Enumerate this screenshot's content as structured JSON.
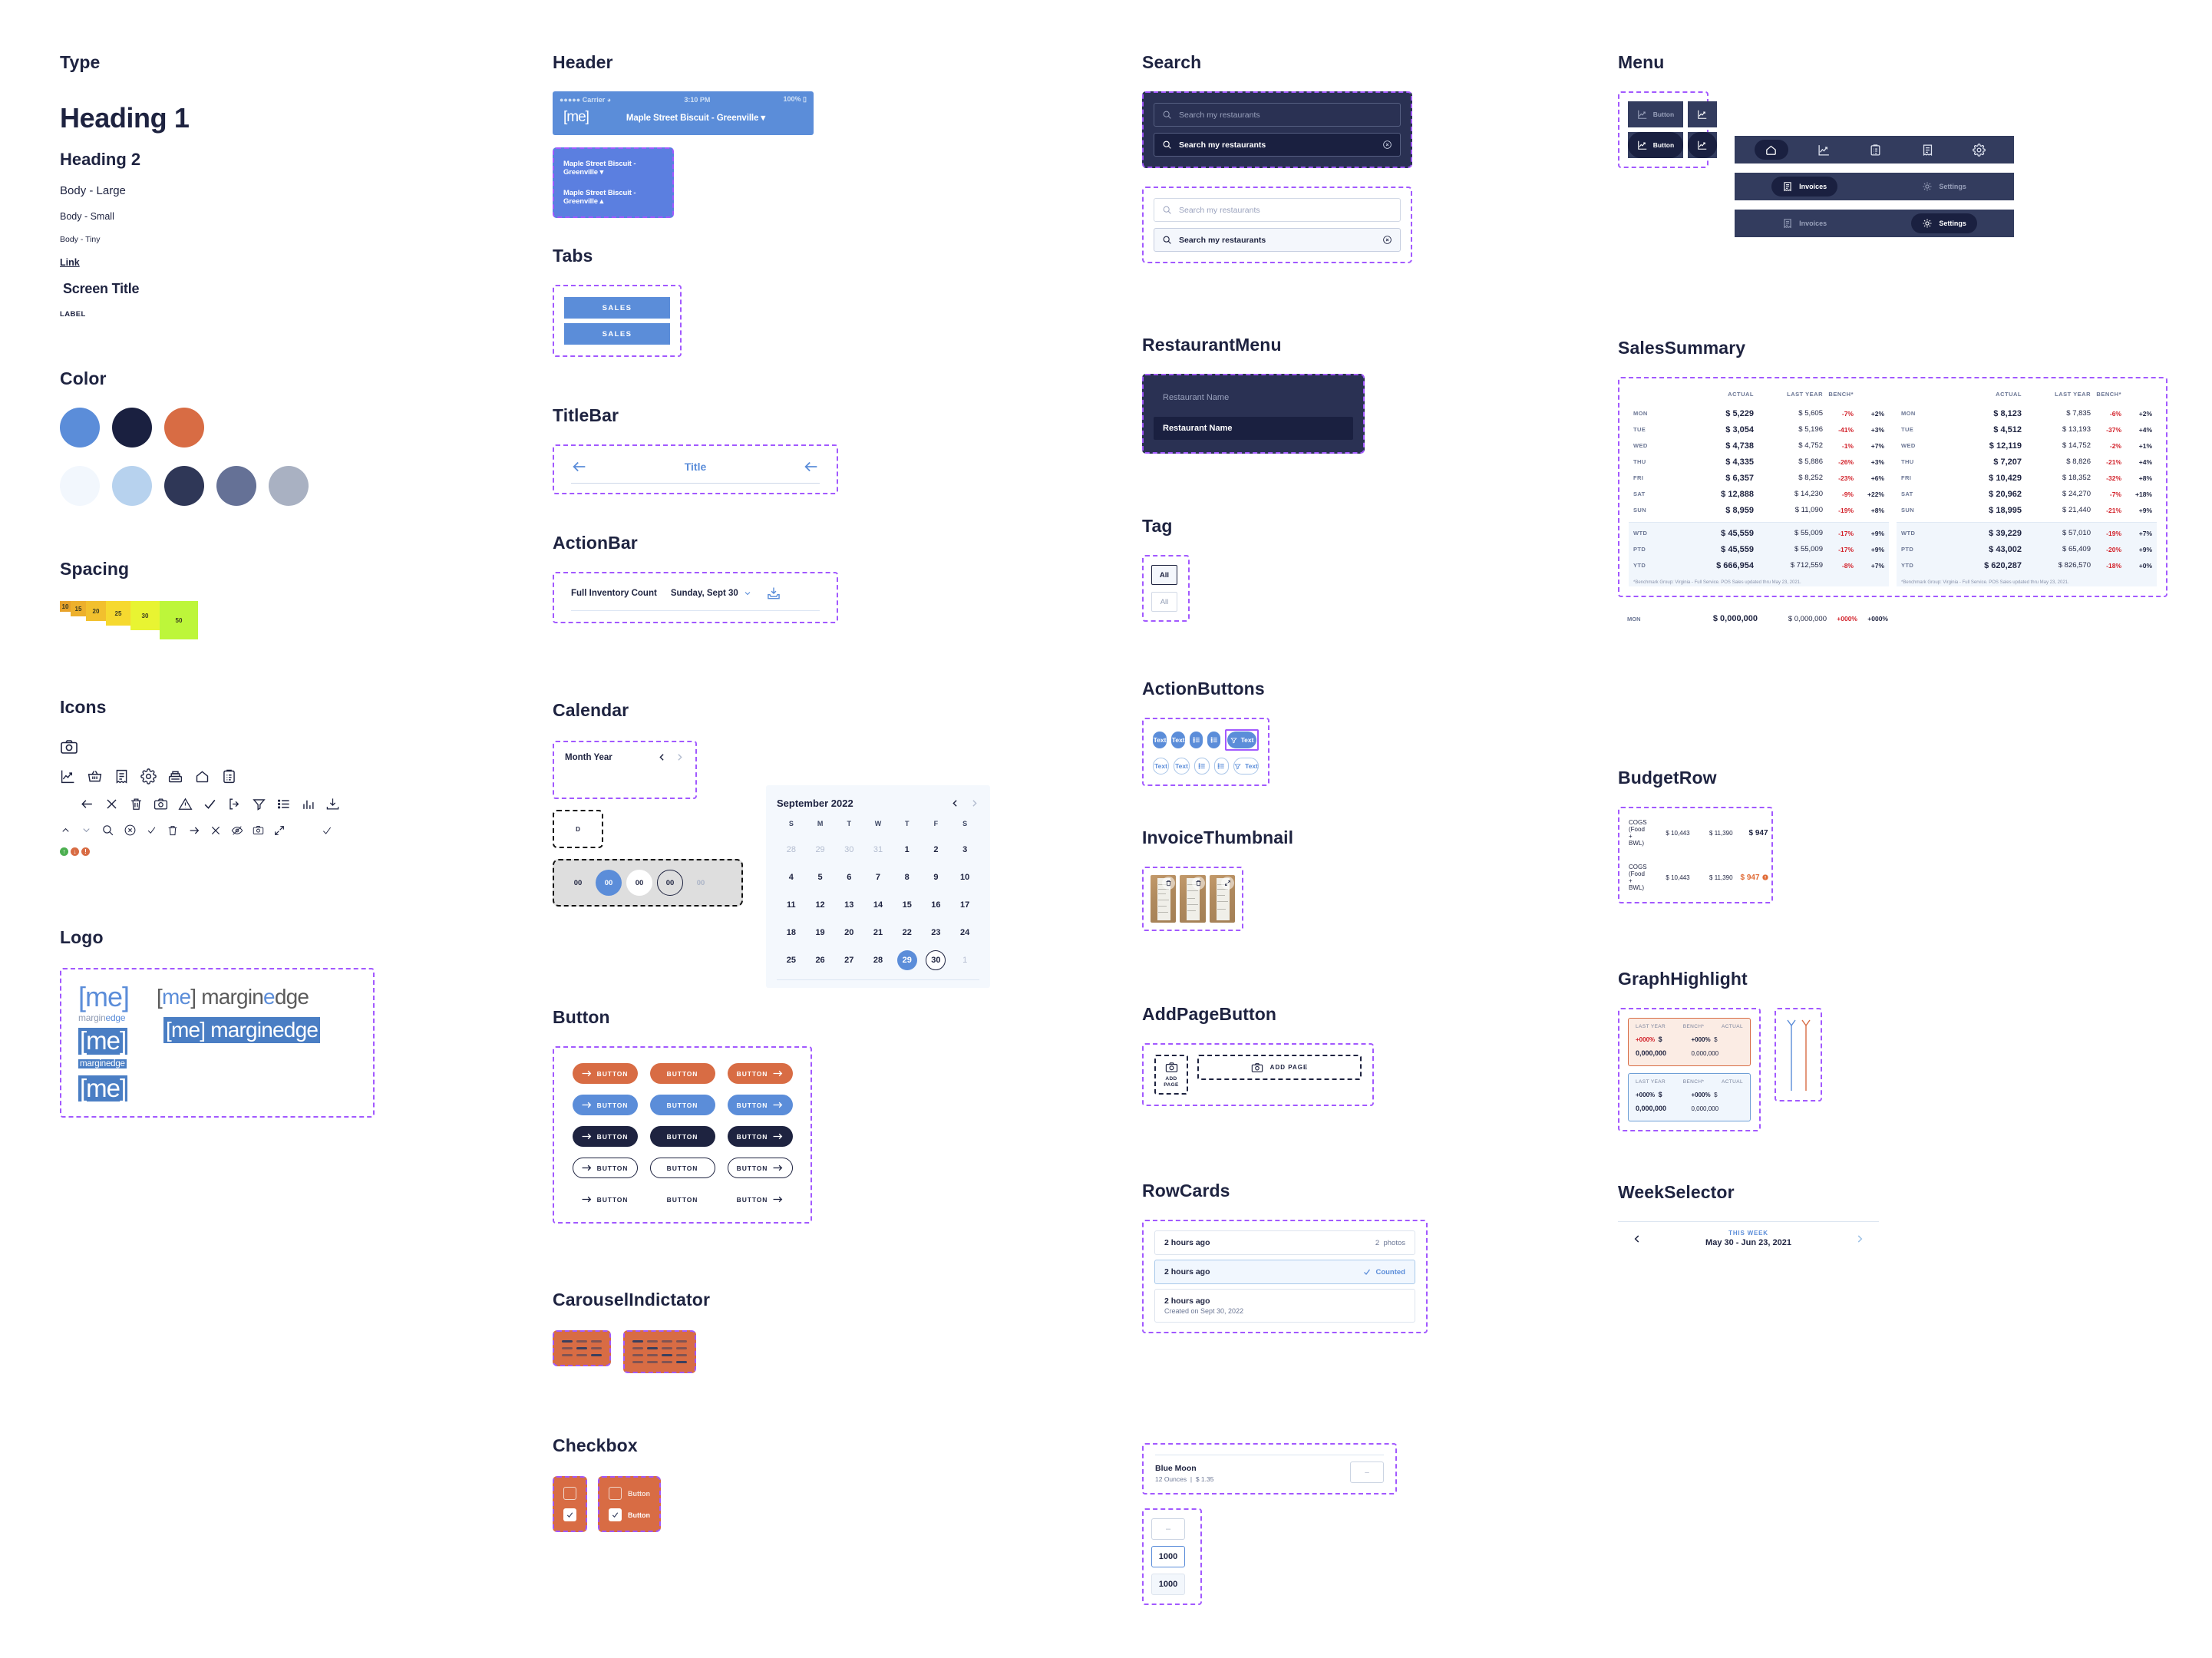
{
  "type": {
    "title": "Type",
    "heading1": "Heading 1",
    "heading2": "Heading 2",
    "body_large": "Body - Large",
    "body_small": "Body - Small",
    "body_tiny": "Body - Tiny",
    "link": "Link",
    "screen_title": "Screen Title",
    "label": "LABEL"
  },
  "color": {
    "title": "Color",
    "row1": [
      "#5b8dd9",
      "#1a2040",
      "#d86c44"
    ],
    "row2": [
      "#f2f7fd",
      "#b7d2ee",
      "#2f3757",
      "#657196",
      "#a9b1c2"
    ]
  },
  "spacing": {
    "title": "Spacing",
    "steps": [
      {
        "label": "10",
        "size": 14,
        "color": "#e8a22a"
      },
      {
        "label": "15",
        "size": 20,
        "color": "#edb02c"
      },
      {
        "label": "20",
        "size": 26,
        "color": "#f2c02e"
      },
      {
        "label": "25",
        "size": 32,
        "color": "#f6d92f"
      },
      {
        "label": "30",
        "size": 38,
        "color": "#e8f432"
      },
      {
        "label": "50",
        "size": 50,
        "color": "#bdf63a"
      }
    ]
  },
  "icons": {
    "title": "Icons",
    "row1": [
      "camera-icon"
    ],
    "row2": [
      "chart-line-icon",
      "basket-icon",
      "receipt-icon",
      "gear-icon",
      "cash-register-icon",
      "home-icon",
      "clipboard-icon"
    ],
    "row3": [
      "arrow-left-icon",
      "close-icon",
      "trash-icon",
      "camera-icon",
      "warning-icon",
      "check-icon",
      "logout-icon",
      "filter-icon",
      "list-icon",
      "bar-chart-icon",
      "download-icon"
    ],
    "row4": [
      "chevron-up-icon",
      "chevron-down-icon",
      "search-icon",
      "clear-circle-icon",
      "check-small-icon",
      "trash-small-icon",
      "arrow-right-icon",
      "close-small-icon",
      "eye-off-icon",
      "camera-small-icon",
      "expand-icon",
      "check-thin-icon"
    ],
    "row5": [
      "status-up-icon",
      "status-down-icon",
      "status-alert-icon"
    ]
  },
  "logo": {
    "title": "Logo",
    "bracket_open": "[",
    "bracket_close": "]",
    "mark": "me",
    "wordmark_margin": "margin",
    "wordmark_edge": "edge",
    "full_light": "[me] marginedge",
    "full_inverse": "[me] marginedge",
    "sub": "marginedge"
  },
  "header": {
    "title": "Header",
    "status_carrier": "Carrier",
    "status_dots": "●●●●●",
    "status_time": "3:10 PM",
    "status_battery": "100%",
    "logo": "[me]",
    "restaurant": "Maple Street Biscuit - Greenville",
    "dropdown_items": [
      "Maple Street Biscuit - Greenville",
      "Maple Street Biscuit - Greenville"
    ]
  },
  "tabs": {
    "title": "Tabs",
    "items": [
      "SALES",
      "SALES"
    ]
  },
  "titlebar": {
    "title": "TitleBar",
    "label": "Title"
  },
  "actionbar": {
    "title": "ActionBar",
    "label": "Full Inventory Count",
    "date": "Sunday, Sept 30",
    "icon": "download-inbox-icon"
  },
  "calendar": {
    "title": "Calendar",
    "month_year_placeholder": "Month Year",
    "day_cell": "D",
    "pills": [
      "00",
      "00",
      "00",
      "00",
      "00"
    ],
    "picker": {
      "month": "September 2022",
      "dow": [
        "S",
        "M",
        "T",
        "W",
        "T",
        "F",
        "S"
      ],
      "weeks": [
        [
          {
            "d": "28",
            "s": "mut"
          },
          {
            "d": "29",
            "s": "mut"
          },
          {
            "d": "30",
            "s": "mut"
          },
          {
            "d": "31",
            "s": "mut"
          },
          {
            "d": "1",
            "s": ""
          },
          {
            "d": "2",
            "s": ""
          },
          {
            "d": "3",
            "s": ""
          }
        ],
        [
          {
            "d": "4",
            "s": ""
          },
          {
            "d": "5",
            "s": ""
          },
          {
            "d": "6",
            "s": ""
          },
          {
            "d": "7",
            "s": ""
          },
          {
            "d": "8",
            "s": ""
          },
          {
            "d": "9",
            "s": ""
          },
          {
            "d": "10",
            "s": ""
          }
        ],
        [
          {
            "d": "11",
            "s": ""
          },
          {
            "d": "12",
            "s": ""
          },
          {
            "d": "13",
            "s": ""
          },
          {
            "d": "14",
            "s": ""
          },
          {
            "d": "15",
            "s": ""
          },
          {
            "d": "16",
            "s": ""
          },
          {
            "d": "17",
            "s": ""
          }
        ],
        [
          {
            "d": "18",
            "s": ""
          },
          {
            "d": "19",
            "s": ""
          },
          {
            "d": "20",
            "s": ""
          },
          {
            "d": "21",
            "s": ""
          },
          {
            "d": "22",
            "s": ""
          },
          {
            "d": "23",
            "s": ""
          },
          {
            "d": "24",
            "s": ""
          }
        ],
        [
          {
            "d": "25",
            "s": ""
          },
          {
            "d": "26",
            "s": ""
          },
          {
            "d": "27",
            "s": ""
          },
          {
            "d": "28",
            "s": ""
          },
          {
            "d": "29",
            "s": "sel"
          },
          {
            "d": "30",
            "s": "out"
          },
          {
            "d": "1",
            "s": "mut"
          }
        ]
      ]
    }
  },
  "button": {
    "title": "Button",
    "label": "BUTTON",
    "variants": [
      "orange",
      "blue",
      "navy",
      "ghost",
      "plain"
    ],
    "arrangements": [
      "label-only",
      "arrow-left",
      "arrow-right"
    ]
  },
  "carousel": {
    "title": "CarouselIndictator",
    "rows_small": 3,
    "rows_large": 4
  },
  "checkbox": {
    "title": "Checkbox",
    "label": "Button"
  },
  "search": {
    "title": "Search",
    "placeholder": "Search my restaurants",
    "value": "Search my restaurants",
    "clear_icon": "clear-circle-icon",
    "search_icon": "search-icon"
  },
  "restaurant_menu": {
    "title": "RestaurantMenu",
    "items": [
      "Restaurant Name",
      "Restaurant Name"
    ]
  },
  "tag": {
    "title": "Tag",
    "items": [
      "All",
      "All"
    ]
  },
  "action_buttons": {
    "title": "ActionButtons",
    "text": "Text",
    "filter_label": "Text",
    "icons": [
      "list-icon",
      "list-icon",
      "filter-icon"
    ]
  },
  "invoice_thumbnail": {
    "title": "InvoiceThumbnail",
    "badges": [
      "trash-icon",
      "trash-icon",
      "expand-icon"
    ]
  },
  "add_page_button": {
    "title": "AddPageButton",
    "square_label": "ADD\nPAGE",
    "square_label_line1": "ADD",
    "square_label_line2": "PAGE",
    "wide_label": "ADD PAGE",
    "icon": "camera-icon"
  },
  "row_cards": {
    "title": "RowCards",
    "rows": [
      {
        "primary": "2 hours ago",
        "secondary": "",
        "right_count": "2",
        "right_label": "photos",
        "state": "default"
      },
      {
        "primary": "2 hours ago",
        "secondary": "",
        "right_count": "",
        "right_label": "Counted",
        "state": "selected"
      },
      {
        "primary": "2 hours ago",
        "secondary": "Created on Sept 30, 2022",
        "right_count": "",
        "right_label": "",
        "state": "default"
      }
    ]
  },
  "item_row": {
    "name": "Blue Moon",
    "size": "12 Ounces",
    "separator": "|",
    "price": "$ 1.35",
    "input_placeholder": "–"
  },
  "stepper": {
    "empty_placeholder": "–",
    "focus_value": "1000",
    "filled_value": "1000"
  },
  "menu": {
    "title": "Menu",
    "button_label": "Button",
    "icon_bar": [
      "home-icon",
      "chart-line-icon",
      "clipboard-icon",
      "receipt-icon",
      "gear-icon"
    ],
    "bar2": [
      {
        "label": "Invoices",
        "icon": "receipt-icon",
        "active": true
      },
      {
        "label": "Settings",
        "icon": "gear-icon",
        "active": false
      }
    ],
    "bar3": [
      {
        "label": "Invoices",
        "icon": "receipt-icon",
        "active": false
      },
      {
        "label": "Settings",
        "icon": "gear-icon",
        "active": true
      }
    ]
  },
  "sales_summary": {
    "title": "SalesSummary",
    "columns": [
      "ACTUAL",
      "LAST YEAR",
      "BENCH*"
    ],
    "footnote": "*Benchmark Group: Virginia - Full Service. POS Sales updated thru May 23, 2021.",
    "left": {
      "days": [
        {
          "day": "MON",
          "actual": "$ 5,229",
          "last_year": "$ 5,605",
          "pct": "-7%",
          "bench": "+2%"
        },
        {
          "day": "TUE",
          "actual": "$ 3,054",
          "last_year": "$ 5,196",
          "pct": "-41%",
          "bench": "+3%"
        },
        {
          "day": "WED",
          "actual": "$ 4,738",
          "last_year": "$ 4,752",
          "pct": "-1%",
          "bench": "+7%"
        },
        {
          "day": "THU",
          "actual": "$ 4,335",
          "last_year": "$ 5,886",
          "pct": "-26%",
          "bench": "+3%"
        },
        {
          "day": "FRI",
          "actual": "$ 6,357",
          "last_year": "$ 8,252",
          "pct": "-23%",
          "bench": "+6%"
        },
        {
          "day": "SAT",
          "actual": "$ 12,888",
          "last_year": "$ 14,230",
          "pct": "-9%",
          "bench": "+22%"
        },
        {
          "day": "SUN",
          "actual": "$ 8,959",
          "last_year": "$ 11,090",
          "pct": "-19%",
          "bench": "+8%"
        }
      ],
      "totals": [
        {
          "day": "WTD",
          "actual": "$ 45,559",
          "last_year": "$ 55,009",
          "pct": "-17%",
          "bench": "+9%"
        },
        {
          "day": "PTD",
          "actual": "$ 45,559",
          "last_year": "$ 55,009",
          "pct": "-17%",
          "bench": "+9%"
        },
        {
          "day": "YTD",
          "actual": "$ 666,954",
          "last_year": "$ 712,559",
          "pct": "-8%",
          "bench": "+7%"
        }
      ]
    },
    "right": {
      "days": [
        {
          "day": "MON",
          "actual": "$ 8,123",
          "last_year": "$ 7,835",
          "pct": "-6%",
          "bench": "+2%"
        },
        {
          "day": "TUE",
          "actual": "$ 4,512",
          "last_year": "$ 13,193",
          "pct": "-37%",
          "bench": "+4%"
        },
        {
          "day": "WED",
          "actual": "$ 12,119",
          "last_year": "$ 14,752",
          "pct": "-2%",
          "bench": "+1%"
        },
        {
          "day": "THU",
          "actual": "$ 7,207",
          "last_year": "$ 8,826",
          "pct": "-21%",
          "bench": "+4%"
        },
        {
          "day": "FRI",
          "actual": "$ 10,429",
          "last_year": "$ 18,352",
          "pct": "-32%",
          "bench": "+8%"
        },
        {
          "day": "SAT",
          "actual": "$ 20,962",
          "last_year": "$ 24,270",
          "pct": "-7%",
          "bench": "+18%"
        },
        {
          "day": "SUN",
          "actual": "$ 18,995",
          "last_year": "$ 21,440",
          "pct": "-21%",
          "bench": "+9%"
        }
      ],
      "totals": [
        {
          "day": "WTD",
          "actual": "$ 39,229",
          "last_year": "$ 57,010",
          "pct": "-19%",
          "bench": "+7%"
        },
        {
          "day": "PTD",
          "actual": "$ 43,002",
          "last_year": "$ 65,409",
          "pct": "-20%",
          "bench": "+9%"
        },
        {
          "day": "YTD",
          "actual": "$ 620,287",
          "last_year": "$ 826,570",
          "pct": "-18%",
          "bench": "+0%"
        }
      ]
    },
    "sample_row": {
      "day": "MON",
      "actual": "$ 0,000,000",
      "last_year": "$ 0,000,000",
      "pct": "+000%",
      "bench": "+000%"
    }
  },
  "budget_row": {
    "title": "BudgetRow",
    "rows": [
      {
        "label": "COGS (Food + BWL)",
        "v1": "$ 10,443",
        "v2": "$ 11,390",
        "total": "$ 947",
        "warn": false
      },
      {
        "label": "COGS (Food + BWL)",
        "v1": "$ 10,443",
        "v2": "$ 11,390",
        "total": "$ 947",
        "warn": true
      }
    ],
    "warn_icon": "alert-icon"
  },
  "graph_highlight": {
    "title": "GraphHighlight",
    "cards": [
      {
        "l1": "LAST YEAR",
        "v1": "+000%",
        "v2": "$ 0,000,000",
        "l2": "BENCH*",
        "v3": "+000%",
        "l3": "ACTUAL",
        "v4": "$ 0,000,000",
        "tone": "red"
      },
      {
        "l1": "LAST YEAR",
        "v1": "+000%",
        "v2": "$ 0,000,000",
        "l2": "BENCH*",
        "v3": "+000%",
        "l3": "ACTUAL",
        "v4": "$ 0,000,000",
        "tone": "blue"
      }
    ],
    "bar_colors": [
      "#5b8dd9",
      "#d86c44"
    ]
  },
  "week_selector": {
    "title": "WeekSelector",
    "this_week": "THIS WEEK",
    "range": "May 30 - Jun 23, 2021",
    "prev_icon": "chevron-left-icon",
    "next_icon": "chevron-right-icon"
  }
}
